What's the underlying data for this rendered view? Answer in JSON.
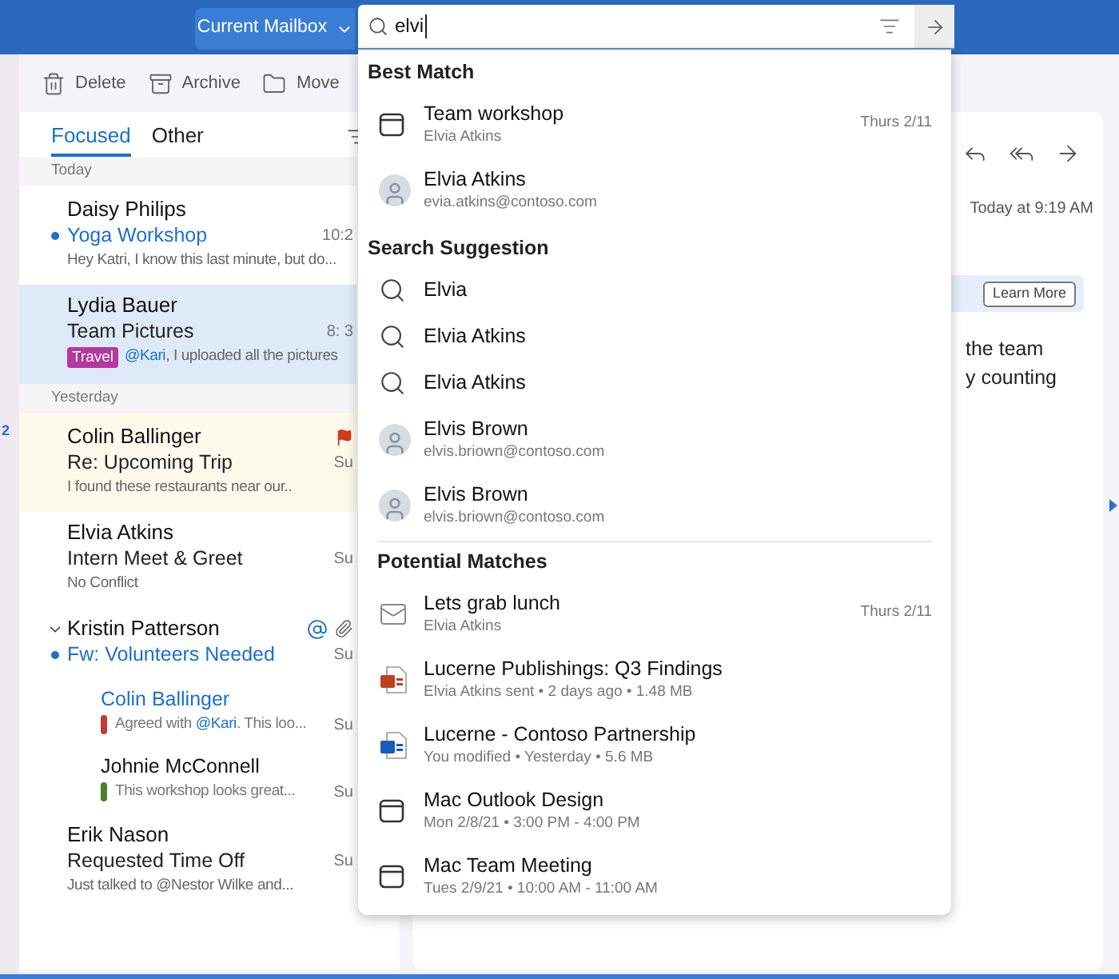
{
  "top_bar": {
    "scope_button": "Current Mailbox",
    "search": {
      "value": "elvi"
    }
  },
  "toolbar": [
    {
      "kind": "trash",
      "label": "Delete"
    },
    {
      "kind": "archive",
      "label": "Archive"
    },
    {
      "kind": "folder",
      "label": "Move"
    }
  ],
  "left_rail": {
    "count": "2"
  },
  "message_list": {
    "tabs": [
      {
        "label": "Focused",
        "selected": true
      },
      {
        "label": "Other",
        "selected": false
      }
    ],
    "groups": [
      {
        "heading": "Today",
        "messages": [
          {
            "sender": "Daisy Philips",
            "subject": "Yoga Workshop",
            "preview": [
              {
                "text": "Hey Katri, I know this last minute, but do..."
              }
            ],
            "time": "10:2",
            "unread": true,
            "selected": false,
            "flagged": false
          },
          {
            "sender": "Lydia Bauer",
            "subject": "Team Pictures",
            "tag": {
              "label": "Travel",
              "color": "#b4389f"
            },
            "preview": [
              {
                "text": "@Kari",
                "kind": "mention"
              },
              {
                "text": ", I uploaded all the pictures"
              }
            ],
            "time": "8: 3",
            "unread": false,
            "selected": true,
            "flagged": false
          }
        ]
      },
      {
        "heading": "Yesterday",
        "messages": [
          {
            "sender": "Colin Ballinger",
            "subject": "Re: Upcoming Trip",
            "preview": [
              {
                "text": "I found these restaurants near our.."
              }
            ],
            "time": "Su",
            "unread": false,
            "selected": false,
            "flagged": true
          },
          {
            "sender": "Elvia Atkins",
            "subject": "Intern Meet & Greet",
            "preview": [
              {
                "text": "No Conflict"
              }
            ],
            "time": "Su",
            "unread": false,
            "selected": false,
            "flagged": false
          },
          {
            "sender": "Kristin Patterson",
            "subject": "Fw: Volunteers Needed",
            "time": "Su",
            "unread": true,
            "selected": false,
            "flagged": false,
            "has_mention": true,
            "has_attachment": true,
            "expanded": true,
            "children": [
              {
                "sender": "Colin Ballinger",
                "preview": [
                  {
                    "text": "Agreed with "
                  },
                  {
                    "text": "@Kari",
                    "kind": "mention"
                  },
                  {
                    "text": ". This loo..."
                  }
                ],
                "time": "Su",
                "unread": true,
                "color": "#c23a3a"
              },
              {
                "sender": "Johnie McConnell",
                "preview": [
                  {
                    "text": "This workshop looks great..."
                  }
                ],
                "time": "Su",
                "unread": false,
                "color": "#4f7f2a"
              }
            ]
          },
          {
            "sender": "Erik Nason",
            "subject": "Requested Time Off",
            "preview": [
              {
                "text": "Just talked to @Nestor Wilke and..."
              }
            ],
            "time": "Su",
            "unread": false,
            "selected": false,
            "flagged": false
          }
        ]
      }
    ]
  },
  "search_results": [
    {
      "heading": "Best Match",
      "separated": false,
      "items": [
        {
          "kind": "event",
          "title": "Team workshop",
          "subtitle": "Elvia Atkins",
          "date": "Thurs 2/11"
        },
        {
          "kind": "person",
          "title": "Elvia Atkins",
          "subtitle": "evia.atkins@contoso.com"
        }
      ]
    },
    {
      "heading": "Search Suggestion",
      "separated": false,
      "items": [
        {
          "kind": "query",
          "title": "Elvia"
        },
        {
          "kind": "query",
          "title": "Elvia Atkins"
        },
        {
          "kind": "query",
          "title": "Elvia Atkins"
        },
        {
          "kind": "person",
          "title": "Elvis Brown",
          "subtitle": "elvis.briown@contoso.com"
        },
        {
          "kind": "person",
          "title": "Elvis Brown",
          "subtitle": "elvis.briown@contoso.com"
        }
      ]
    },
    {
      "heading": "Potential Matches",
      "separated": true,
      "items": [
        {
          "kind": "mail",
          "title": "Lets grab lunch",
          "subtitle": "Elvia Atkins",
          "date": "Thurs 2/11"
        },
        {
          "kind": "slides",
          "title": "Lucerne Publishings: Q3 Findings",
          "subtitle": "Elvia Atkins sent • 2 days ago • 1.48 MB"
        },
        {
          "kind": "document",
          "title": "Lucerne - Contoso Partnership",
          "subtitle": "You modified • Yesterday • 5.6 MB"
        },
        {
          "kind": "event",
          "title": "Mac Outlook Design",
          "subtitle": "Mon 2/8/21 • 3:00 PM - 4:00 PM"
        },
        {
          "kind": "event",
          "title": "Mac Team Meeting",
          "subtitle": "Tues 2/9/21 • 10:00 AM - 11:00 AM"
        }
      ]
    }
  ],
  "reading_pane": {
    "actions": [
      {
        "kind": "reply"
      },
      {
        "kind": "reply_all"
      },
      {
        "kind": "forward"
      }
    ],
    "timestamp": "Today at 9:19 AM",
    "banner": {
      "button": "Learn More"
    },
    "body_lines": [
      "the team",
      "y counting"
    ]
  }
}
